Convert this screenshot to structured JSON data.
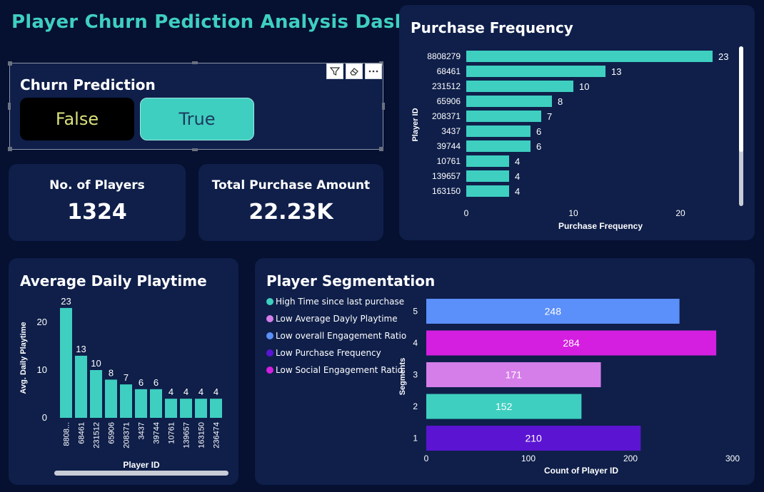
{
  "dashboard": {
    "title": "Player Churn Pediction Analysis Dashboard"
  },
  "churn_slicer": {
    "title": "Churn Prediction",
    "options": [
      "False",
      "True"
    ],
    "selected": "True"
  },
  "kpis": {
    "players": {
      "label": "No. of Players",
      "value": "1324"
    },
    "purchase_amount": {
      "label": "Total Purchase Amount",
      "value": "22.23K"
    }
  },
  "purchase_frequency": {
    "title": "Purchase Frequency"
  },
  "daily_playtime": {
    "title": "Average Daily Playtime"
  },
  "segmentation": {
    "title": "Player Segmentation",
    "legend": [
      {
        "label": "High Time since last purchase",
        "color": "#3ecfc0"
      },
      {
        "label": "Low Average Dayly Playtime",
        "color": "#d57eea"
      },
      {
        "label": "Low overall Engagement Ratio",
        "color": "#5b8ff9"
      },
      {
        "label": "Low Purchase Frequency",
        "color": "#5b14d2"
      },
      {
        "label": "Low Social Engagement Ratio",
        "color": "#d41fe0"
      }
    ]
  },
  "chart_data": [
    {
      "id": "purchase_frequency",
      "type": "bar",
      "orientation": "horizontal",
      "categories": [
        "8808279",
        "68461",
        "231512",
        "65906",
        "208371",
        "3437",
        "39744",
        "10761",
        "139657",
        "163150"
      ],
      "values": [
        23,
        13,
        10,
        8,
        7,
        6,
        6,
        4,
        4,
        4
      ],
      "xlabel": "Purchase Frequency",
      "ylabel": "Player ID",
      "xticks": [
        0,
        10,
        20
      ],
      "color": "#3ecfc0"
    },
    {
      "id": "daily_playtime",
      "type": "bar",
      "orientation": "vertical",
      "categories": [
        "8808...",
        "68461",
        "231512",
        "65906",
        "208371",
        "3437",
        "39744",
        "10761",
        "139657",
        "163150",
        "236474"
      ],
      "values": [
        23,
        13,
        10,
        8,
        7,
        6,
        6,
        4,
        4,
        4,
        4
      ],
      "xlabel": "Player ID",
      "ylabel": "Avg. Daily Playtime",
      "yticks": [
        0,
        10,
        20
      ],
      "color": "#3ecfc0"
    },
    {
      "id": "segmentation",
      "type": "bar",
      "orientation": "horizontal",
      "categories": [
        "5",
        "4",
        "3",
        "2",
        "1"
      ],
      "values": [
        248,
        284,
        171,
        152,
        210
      ],
      "colors": [
        "#5b8ff9",
        "#d41fe0",
        "#d57eea",
        "#3ecfc0",
        "#5b14d2"
      ],
      "xlabel": "Count of Player ID",
      "ylabel": "Segments",
      "xticks": [
        0,
        100,
        200,
        300
      ],
      "xlim": [
        0,
        300
      ]
    }
  ]
}
